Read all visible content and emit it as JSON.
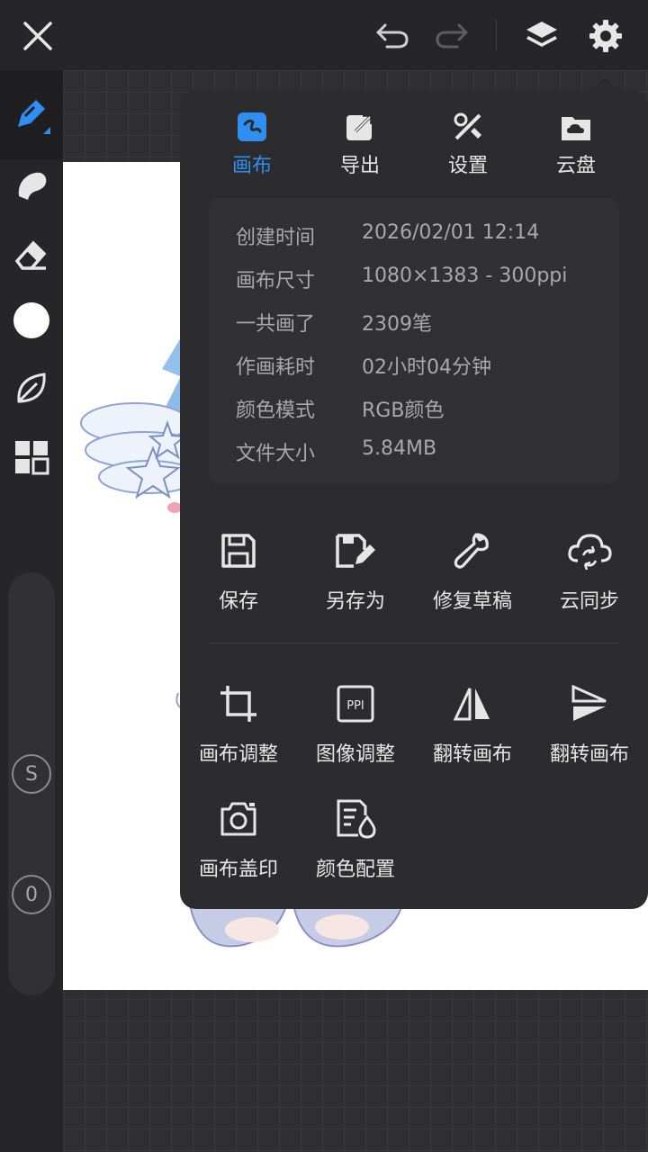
{
  "topbar": {
    "icons": [
      "close-icon",
      "undo-icon",
      "redo-icon",
      "layers-icon",
      "settings-icon"
    ]
  },
  "toolbar": {
    "tools": [
      "brush-tool-icon",
      "smudge-tool-icon",
      "eraser-tool-icon",
      "color-swatch",
      "leaf-brush-icon",
      "grid-panel-icon"
    ],
    "color": "#ffffff",
    "slider_size_label": "S",
    "slider_opacity_label": "0"
  },
  "panel": {
    "tabs": [
      {
        "label": "画布",
        "icon": "canvas-tab-icon",
        "active": true
      },
      {
        "label": "导出",
        "icon": "export-tab-icon",
        "active": false
      },
      {
        "label": "设置",
        "icon": "settings-tab-icon",
        "active": false
      },
      {
        "label": "云盘",
        "icon": "cloud-drive-tab-icon",
        "active": false
      }
    ],
    "info": [
      {
        "key": "创建时间",
        "value": "2026/02/01 12:14"
      },
      {
        "key": "画布尺寸",
        "value": "1080×1383 - 300ppi"
      },
      {
        "key": "一共画了",
        "value": "2309笔"
      },
      {
        "key": "作画耗时",
        "value": "02小时04分钟"
      },
      {
        "key": "颜色模式",
        "value": "RGB颜色"
      },
      {
        "key": "文件大小",
        "value": "5.84MB"
      }
    ],
    "actions_row1": [
      {
        "label": "保存",
        "icon": "save-icon"
      },
      {
        "label": "另存为",
        "icon": "save-as-icon"
      },
      {
        "label": "修复草稿",
        "icon": "repair-draft-icon"
      },
      {
        "label": "云同步",
        "icon": "cloud-sync-icon"
      }
    ],
    "actions_row2": [
      {
        "label": "画布调整",
        "icon": "crop-icon"
      },
      {
        "label": "图像调整",
        "icon": "ppi-icon"
      },
      {
        "label": "翻转画布",
        "icon": "flip-horizontal-icon"
      },
      {
        "label": "翻转画布",
        "icon": "flip-vertical-icon"
      }
    ],
    "actions_row3": [
      {
        "label": "画布盖印",
        "icon": "camera-icon"
      },
      {
        "label": "颜色配置",
        "icon": "color-profile-icon"
      }
    ]
  },
  "colors": {
    "accent": "#2f8ff0",
    "panel_bg": "#2c2c2e",
    "toolbar_bg": "#262628"
  }
}
